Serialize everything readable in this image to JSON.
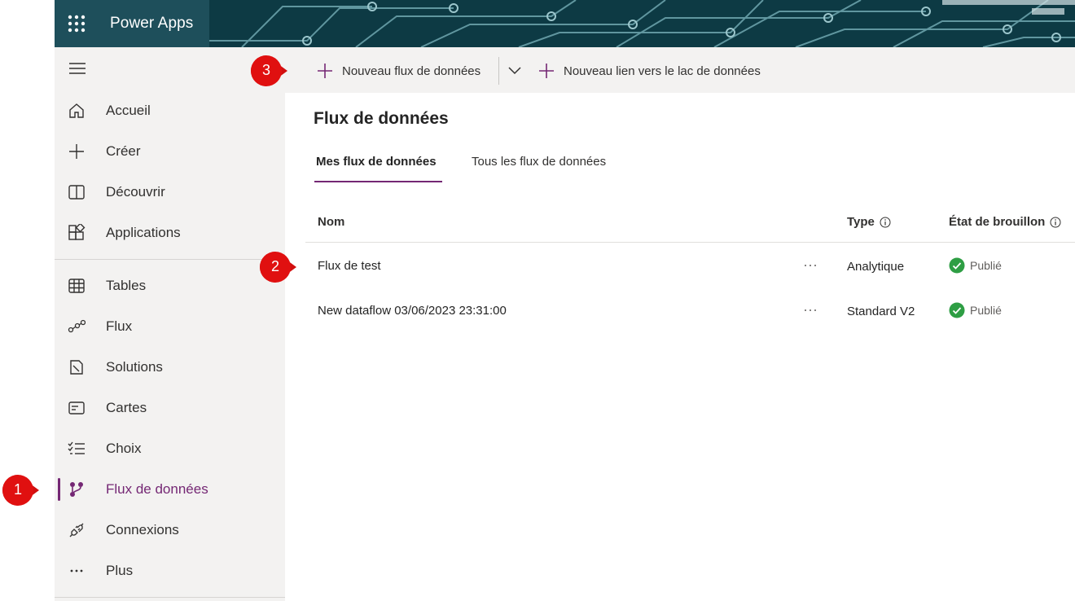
{
  "header": {
    "app_title": "Power Apps",
    "waffle_icon": "waffle-icon",
    "bg_color": "#0b3b46"
  },
  "sidebar": {
    "items": [
      {
        "label": "Accueil",
        "icon": "home-icon"
      },
      {
        "label": "Créer",
        "icon": "plus-icon"
      },
      {
        "label": "Découvrir",
        "icon": "book-icon"
      },
      {
        "label": "Applications",
        "icon": "apps-icon"
      },
      {
        "label": "Tables",
        "icon": "table-icon"
      },
      {
        "label": "Flux",
        "icon": "flow-icon"
      },
      {
        "label": "Solutions",
        "icon": "solutions-icon"
      },
      {
        "label": "Cartes",
        "icon": "card-icon"
      },
      {
        "label": "Choix",
        "icon": "choices-icon"
      },
      {
        "label": "Flux de données",
        "icon": "dataflow-icon",
        "active": true
      },
      {
        "label": "Connexions",
        "icon": "plug-icon"
      },
      {
        "label": "Plus",
        "icon": "more-icon"
      }
    ],
    "accent_color": "#742774"
  },
  "toolbar": {
    "new_dataflow_label": "Nouveau flux de données",
    "new_lake_link_label": "Nouveau lien vers le lac de données"
  },
  "main": {
    "title": "Flux de données",
    "tabs": [
      {
        "label": "Mes flux de données",
        "active": true
      },
      {
        "label": "Tous les flux de données",
        "active": false
      }
    ],
    "columns": {
      "name": "Nom",
      "type": "Type",
      "draft_state": "État de brouillon"
    },
    "rows": [
      {
        "name": "Flux de test",
        "type": "Analytique",
        "status": "Publié"
      },
      {
        "name": "New dataflow 03/06/2023 23:31:00",
        "type": "Standard V2",
        "status": "Publié"
      }
    ],
    "status_color": "#2e9e44"
  },
  "callouts": [
    "1",
    "2",
    "3"
  ]
}
